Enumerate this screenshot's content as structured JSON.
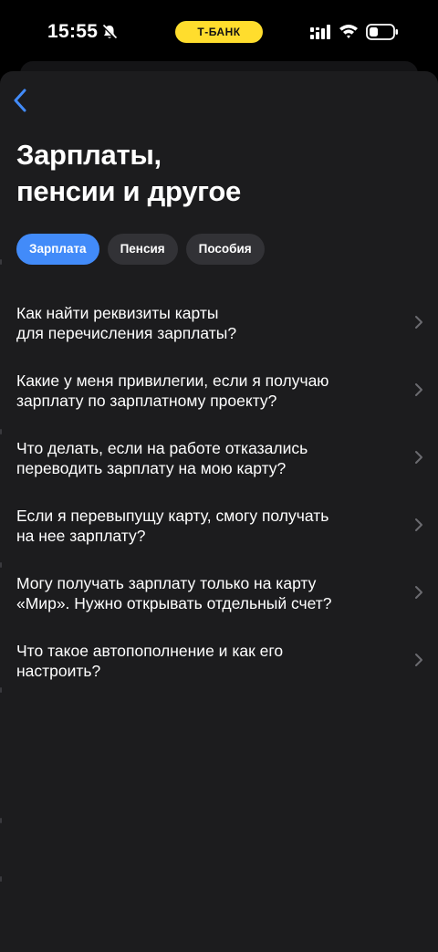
{
  "status_bar": {
    "time": "15:55",
    "carrier_badge": "Т-БАНК",
    "icons": [
      "bell-slash-icon",
      "signal-icon",
      "wifi-icon",
      "battery-icon"
    ]
  },
  "header": {
    "back_icon": "chevron-left-icon",
    "title_line1": "Зарплаты,",
    "title_line2": "пенсии и другое"
  },
  "tabs": [
    {
      "label": "Зарплата",
      "active": true
    },
    {
      "label": "Пенсия",
      "active": false
    },
    {
      "label": "Пособия",
      "active": false
    }
  ],
  "faq": [
    {
      "line1": "Как найти реквизиты карты",
      "line2": "для перечисления зарплаты?"
    },
    {
      "line1": "Какие у меня привилегии, если я получаю",
      "line2": "зарплату по зарплатному проекту?"
    },
    {
      "line1": "Что делать, если на работе отказались",
      "line2": "переводить зарплату на мою карту?"
    },
    {
      "line1": "Если я перевыпущу карту, смогу получать",
      "line2": "на нее зарплату?"
    },
    {
      "line1": "Могу получать зарплату только на карту",
      "line2": "«Мир». Нужно открывать отдельный счет?"
    },
    {
      "line1": "Что такое автопополнение и как его",
      "line2": "настроить?"
    }
  ],
  "colors": {
    "background": "#000000",
    "sheet": "#1c1c1e",
    "accent": "#428bf9",
    "tab_inactive": "#323236",
    "brand_yellow": "#ffdd2d",
    "chevron": "#6b6b70"
  }
}
